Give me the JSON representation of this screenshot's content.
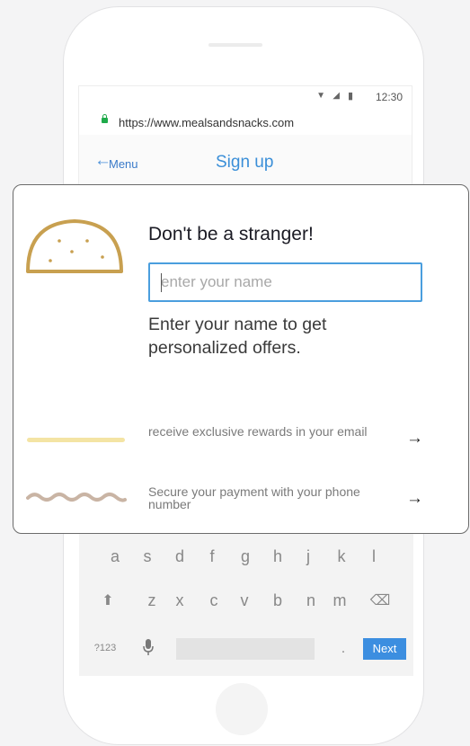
{
  "status_bar": {
    "time": "12:30",
    "wifi_icon": "wifi-icon",
    "signal_icon": "signal-icon",
    "battery_icon": "battery-icon"
  },
  "browser": {
    "url": "https://www.mealsandsnacks.com",
    "lock_icon": "lock-icon"
  },
  "nav": {
    "back_label": "Menu",
    "title": "Sign up",
    "back_icon": "arrow-left-icon"
  },
  "card": {
    "heading": "Don't be a stranger!",
    "name_input": {
      "placeholder": "enter your name",
      "value": ""
    },
    "description": "Enter your name to get personalized offers.",
    "features": [
      {
        "text": "receive exclusive rewards in your email",
        "arrow": "→"
      },
      {
        "text": "Secure your payment with your phone number",
        "arrow": "→"
      }
    ]
  },
  "keyboard": {
    "row1": [
      "a",
      "s",
      "d",
      "f",
      "g",
      "h",
      "j",
      "k",
      "l"
    ],
    "row2": [
      "z",
      "x",
      "c",
      "v",
      "b",
      "n",
      "m"
    ],
    "symbols_key": "?123",
    "period_key": ".",
    "next_key": "Next",
    "shift_icon": "shift-icon",
    "backspace_icon": "backspace-icon",
    "mic_icon": "microphone-icon"
  },
  "colors": {
    "accent": "#3b8fd8",
    "next_key": "#3c8ee0",
    "taco": "#c8a050",
    "yellow_line": "#f4e4a4",
    "wave": "#c9b4a4",
    "lock": "#1faa4a"
  }
}
